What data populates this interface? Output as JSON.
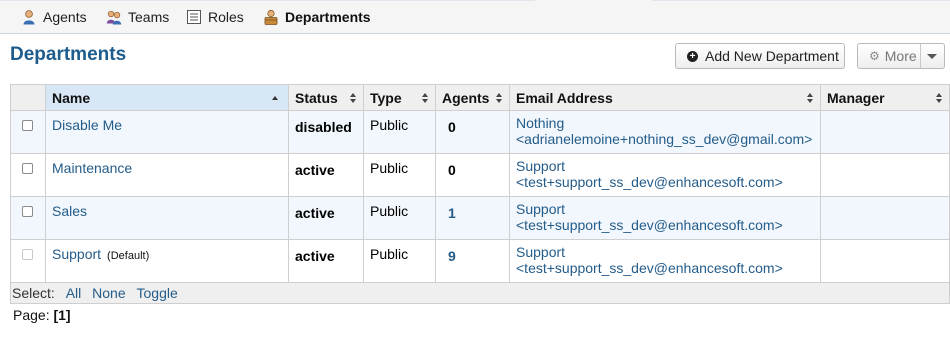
{
  "nav": {
    "items": [
      {
        "label": "Agents",
        "icon": "agent-icon"
      },
      {
        "label": "Teams",
        "icon": "teams-icon"
      },
      {
        "label": "Roles",
        "icon": "roles-icon"
      },
      {
        "label": "Departments",
        "icon": "department-icon"
      }
    ]
  },
  "page": {
    "title": "Departments",
    "add_button": "Add New Department",
    "more_button": "More"
  },
  "table": {
    "columns": [
      "Name",
      "Status",
      "Type",
      "Agents",
      "Email Address",
      "Manager"
    ],
    "rows": [
      {
        "name": "Disable Me",
        "default_tag": "",
        "status": "disabled",
        "type": "Public",
        "agents": "0",
        "email_name": "Nothing",
        "email_address": "<adrianelemoine+nothing_ss_dev@gmail.com>",
        "manager": ""
      },
      {
        "name": "Maintenance",
        "default_tag": "",
        "status": "active",
        "type": "Public",
        "agents": "0",
        "email_name": "Support",
        "email_address": "<test+support_ss_dev@enhancesoft.com>",
        "manager": ""
      },
      {
        "name": "Sales",
        "default_tag": "",
        "status": "active",
        "type": "Public",
        "agents": "1",
        "email_name": "Support",
        "email_address": "<test+support_ss_dev@enhancesoft.com>",
        "manager": ""
      },
      {
        "name": "Support",
        "default_tag": "(Default)",
        "status": "active",
        "type": "Public",
        "agents": "9",
        "email_name": "Support",
        "email_address": "<test+support_ss_dev@enhancesoft.com>",
        "manager": ""
      }
    ],
    "select": {
      "label": "Select:",
      "all": "All",
      "none": "None",
      "toggle": "Toggle"
    }
  },
  "pager": {
    "label": "Page:",
    "current": "[1]"
  },
  "colors": {
    "accent": "#1d5c8c",
    "link": "#245c8a",
    "row_alt": "#f1f7fc"
  }
}
